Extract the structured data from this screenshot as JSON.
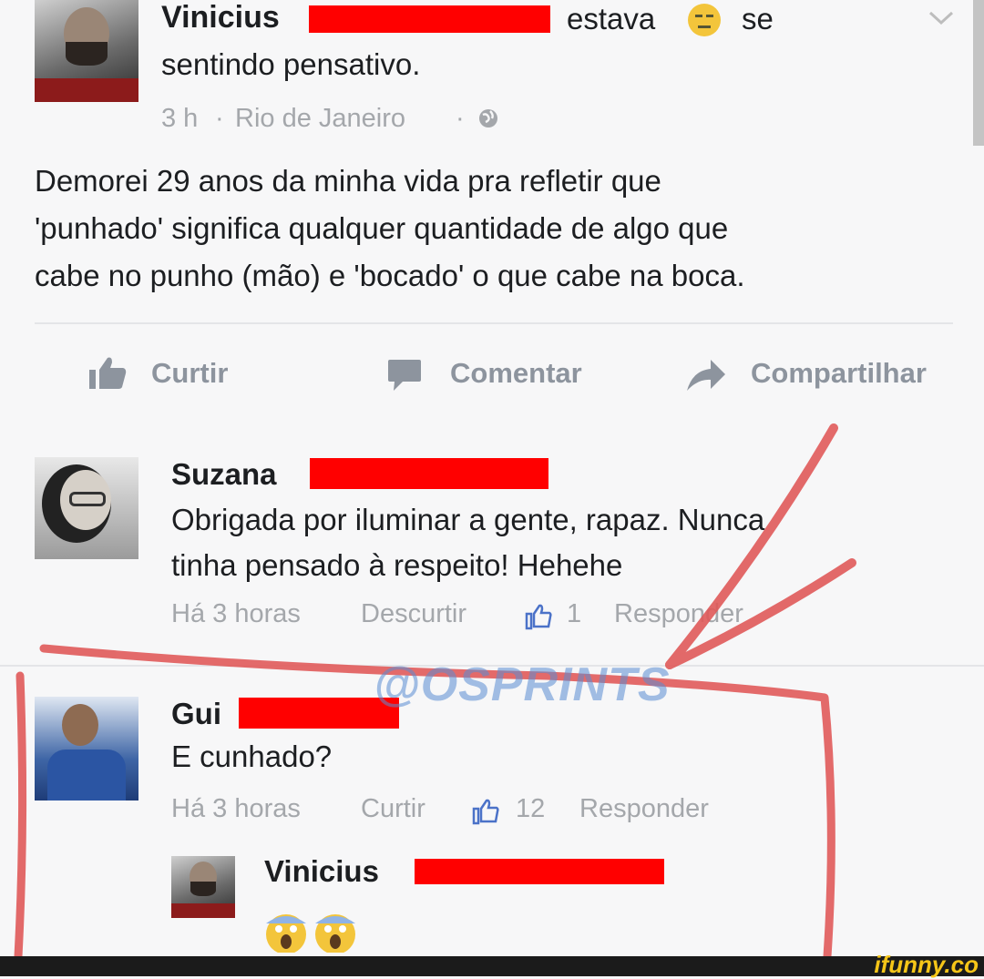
{
  "post": {
    "author_first": "Vinicius",
    "status_word": "estava",
    "status_tail": "se",
    "status_line2": "sentindo pensativo.",
    "meta_time": "3 h",
    "meta_sep1": "·",
    "meta_location": "Rio de Janeiro",
    "meta_sep2": "·",
    "body_line1": "Demorei 29 anos da minha vida pra refletir que",
    "body_line2": "'punhado' significa qualquer quantidade de algo que",
    "body_line3": "cabe no punho (mão) e 'bocado' o que cabe na boca."
  },
  "actions": {
    "like": "Curtir",
    "comment": "Comentar",
    "share": "Compartilhar"
  },
  "comments": [
    {
      "author": "Suzana",
      "text_line1": "Obrigada por iluminar a gente, rapaz. Nunca",
      "text_line2": "tinha pensado à respeito! Hehehe",
      "time": "Há 3 horas",
      "action": "Descurtir",
      "likes": "1",
      "reply": "Responder"
    },
    {
      "author": "Gui",
      "text_line1": "E cunhado?",
      "time": "Há 3 horas",
      "action": "Curtir",
      "likes": "12",
      "reply": "Responder"
    }
  ],
  "reply": {
    "author": "Vinicius",
    "emoji": "😱😱"
  },
  "watermark": "@OSPRINTS",
  "brand": "ifunny.co",
  "colors": {
    "redaction": "#ff0000",
    "annotation": "#e05a5a",
    "meta_text": "#a4a7ab",
    "action_text": "#8d949e",
    "ifunny_bar": "#1b1b1b",
    "ifunny_text": "#f5c518"
  },
  "icons": [
    "chevron-down-icon",
    "globe-icon",
    "thumbs-up-icon",
    "comment-icon",
    "share-arrow-icon",
    "small-like-icon",
    "scared-emoji-icon",
    "unamused-emoji-icon"
  ]
}
